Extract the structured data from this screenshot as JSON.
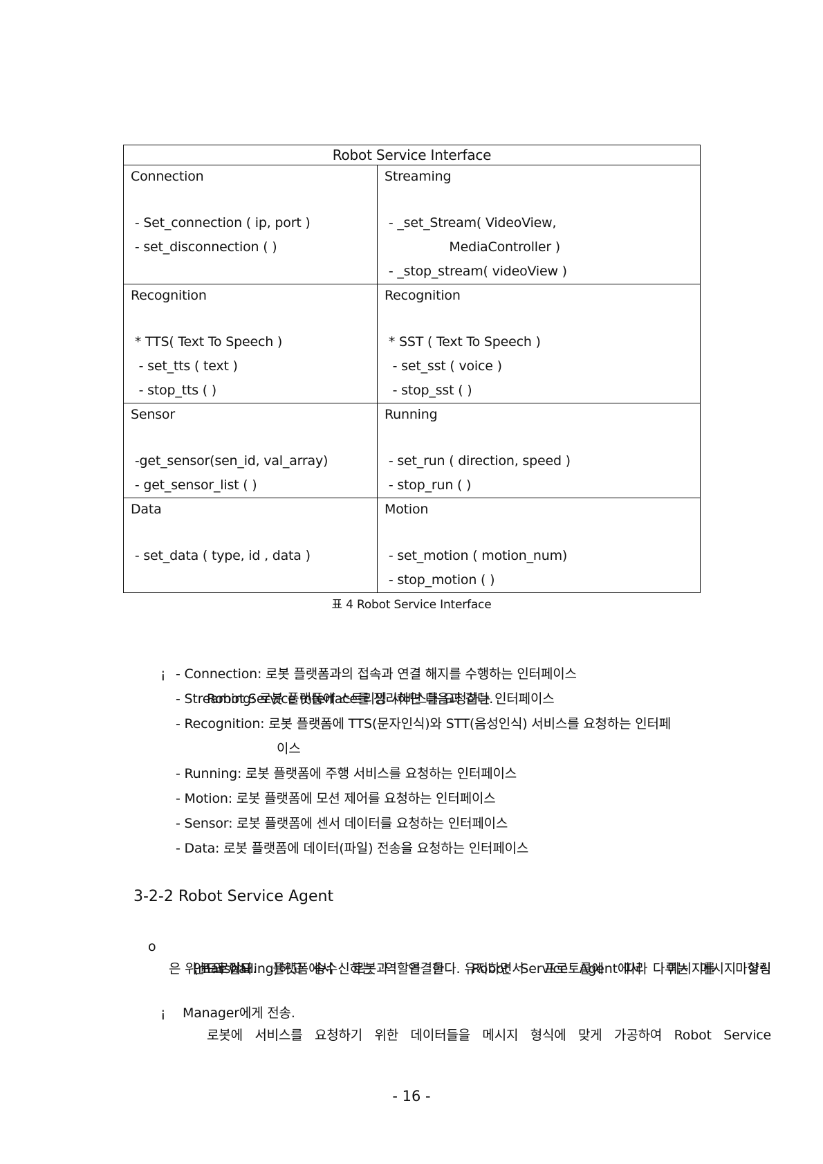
{
  "table": {
    "title": "Robot Service Interface",
    "rows": [
      [
        {
          "title": "Connection",
          "lines": [
            " - Set_connection ( ip, port )",
            " - set_disconnection ( )"
          ]
        },
        {
          "title": "Streaming",
          "lines": [
            " - _set_Stream( VideoView,",
            "                MediaController )",
            " - _stop_stream( videoView )"
          ]
        }
      ],
      [
        {
          "title": "Recognition",
          "lines": [
            " * TTS( Text To Speech )",
            "  - set_tts ( text )",
            "  - stop_tts ( )"
          ]
        },
        {
          "title": "Recognition",
          "lines": [
            " * SST ( Text To Speech )",
            "  - set_sst ( voice )",
            "  - stop_sst ( )"
          ]
        }
      ],
      [
        {
          "title": "Sensor",
          "lines": [
            " -get_sensor(sen_id, val_array)",
            " - get_sensor_list ( )"
          ]
        },
        {
          "title": "Running",
          "lines": [
            " - set_run ( direction, speed )",
            " - stop_run ( )"
          ]
        }
      ],
      [
        {
          "title": "Data",
          "lines": [
            " - set_data ( type, id , data )"
          ]
        },
        {
          "title": "Motion",
          "lines": [
            " - set_motion ( motion_num)",
            " - stop_motion ( )"
          ]
        }
      ]
    ]
  },
  "caption": "표 4 Robot Service Interface",
  "summary": {
    "bullet": "¡",
    "lead": "Robot Service Interface를 정리하면 다음과 같다.",
    "items": [
      "- Connection: 로봇 플랫폼과의 접속과 연결 해지를 수행하는 인터페이스",
      "- Streaming: 로봇 플랫폼에 스트리밍 서비스를 요청하는 인터페이스",
      "- Recognition: 로봇 플랫폼에 TTS(문자인식)와 STT(음성인식) 서비스를 요청하는 인터페",
      "이스",
      "- Running: 로봇 플랫폼에 주행 서비스를 요청하는 인터페이스",
      "- Motion: 로봇 플랫폼에 모션 제어를 요청하는 인터페이스",
      "- Sensor: 로봇 플랫폼에 센서 데이터를 요청하는 인터페이스",
      "- Data: 로봇 플랫폼에 데이터(파일) 전송을 요청하는 인터페이스"
    ]
  },
  "section": {
    "title": "3-2-2 Robot Service Agent",
    "bullet_o": "o",
    "para1_line1": "안드로이드 플랫폼에서 로봇과 연결을 유지하면서 프로토콜에 따라 메시지를 마샬링",
    "para1_line2": "(marshalling)하고 송수신하는 역할을 한다. Robot Service Agent에서 다루는 메시지 형식",
    "para1_line3": "은 위 표와 같다.",
    "bullet_i": "¡",
    "para2_line1": "로봇에 서비스를 요청하기 위한 데이터들을 메시지 형식에 맞게 가공하여 Robot Service",
    "para2_line2": "Manager에게 전송."
  },
  "page_number": "- 16 -"
}
